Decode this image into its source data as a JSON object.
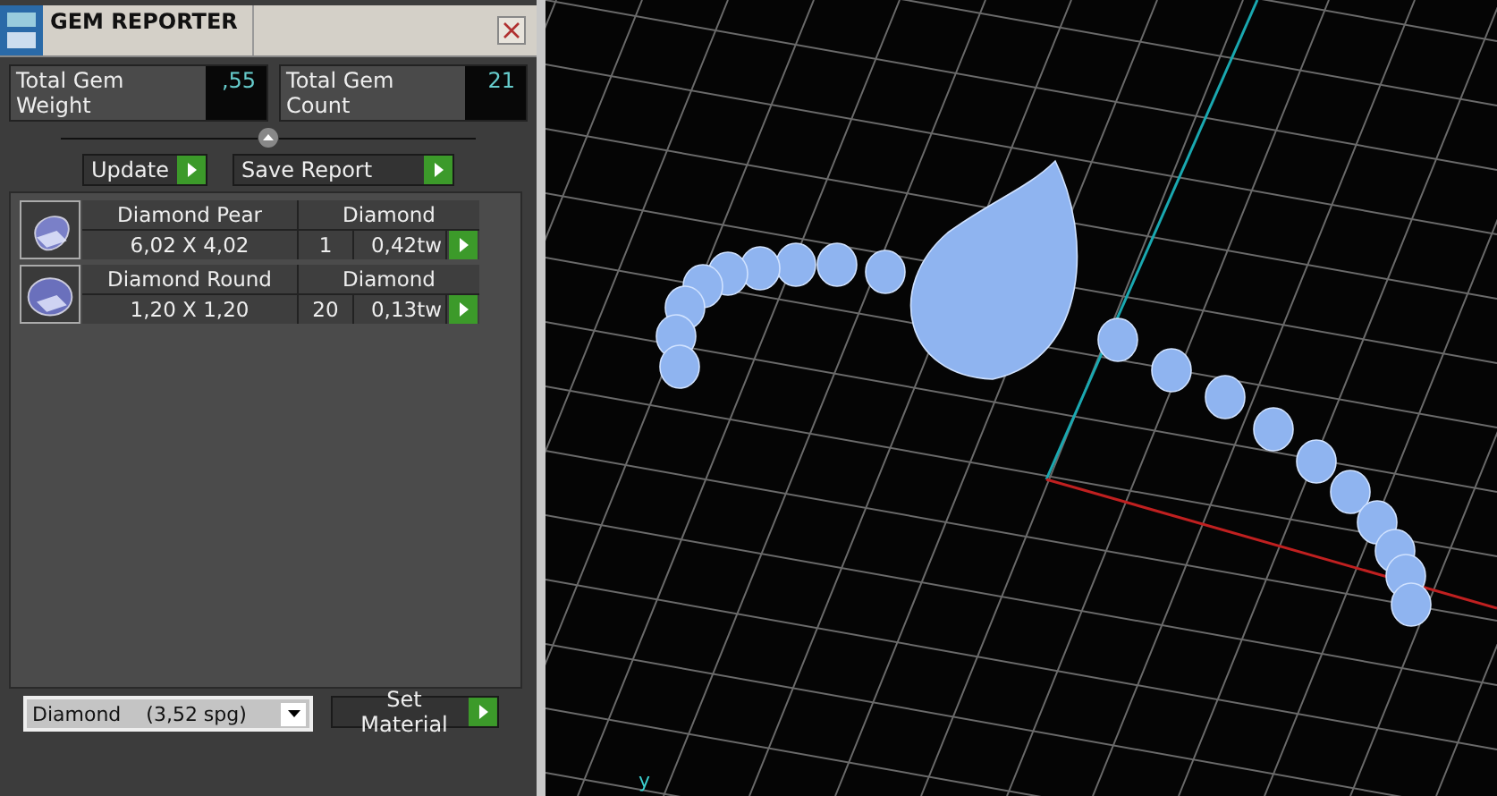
{
  "window": {
    "title": "GEM REPORTER"
  },
  "totals": [
    {
      "label": "Total Gem Weight",
      "value": ",55"
    },
    {
      "label": "Total Gem Count",
      "value": "21"
    }
  ],
  "buttons": [
    "Update",
    "Save Report"
  ],
  "gems": [
    {
      "kind": "pear",
      "name": "Diamond Pear",
      "material": "Diamond",
      "size": "6,02 X 4,02",
      "count": "1",
      "weight": "0,42tw"
    },
    {
      "kind": "round",
      "name": "Diamond Round",
      "material": "Diamond",
      "size": "1,20 X 1,20",
      "count": "20",
      "weight": "0,13tw"
    }
  ],
  "material_select": {
    "value": "Diamond    (3,52 spg)"
  },
  "set_material_button": "Set Material",
  "viewport": {
    "axis_label": "y"
  }
}
